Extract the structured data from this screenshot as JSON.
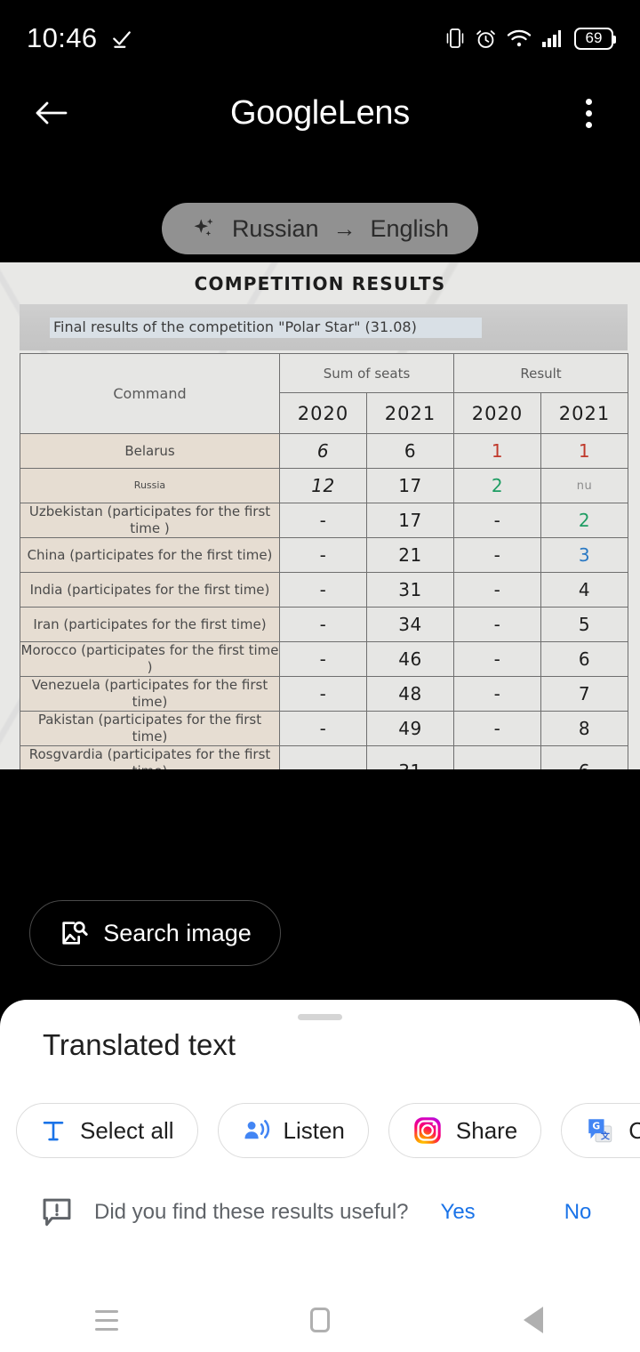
{
  "status_bar": {
    "time": "10:46",
    "check_icon": "check-icon",
    "vibrate_icon": "vibrate-icon",
    "alarm_icon": "alarm-icon",
    "wifi_icon": "wifi-icon",
    "signal_icon": "cellular-signal-icon",
    "battery_level": "69"
  },
  "app_bar": {
    "back_icon": "back-arrow-icon",
    "title_primary": "Google",
    "title_secondary": "Lens",
    "overflow_icon": "more-vertical-icon"
  },
  "language_chip": {
    "sparkle_icon": "sparkle-icon",
    "source_language": "Russian",
    "arrow": "→",
    "target_language": "English"
  },
  "document": {
    "heading": "COMPETITION RESULTS",
    "caption": "Final results of the competition \"Polar Star\" (31.08)",
    "table": {
      "col_command": "Command",
      "group_headers": [
        "Sum of seats",
        "Result"
      ],
      "year_headers": [
        "2020",
        "2021",
        "2020",
        "2021"
      ],
      "rows": [
        {
          "name": "Belarus",
          "seats_2020": "6",
          "seats_2021": "6",
          "result_2020": "1",
          "result_2021": "1",
          "r20_color": "red",
          "r21_color": "red",
          "name_style": "normal",
          "s20_style": "italic",
          "s21_style": "normal"
        },
        {
          "name": "Russia",
          "seats_2020": "12",
          "seats_2021": "17",
          "result_2020": "2",
          "result_2021": "nu",
          "r20_color": "green",
          "r21_color": "faint",
          "name_style": "small",
          "s20_style": "italic",
          "s21_style": "normal"
        },
        {
          "name": "Uzbekistan (participates for the first time )",
          "seats_2020": "-",
          "seats_2021": "17",
          "result_2020": "-",
          "result_2021": "2",
          "r20_color": "",
          "r21_color": "green",
          "name_style": "normal",
          "s20_style": "normal",
          "s21_style": "normal"
        },
        {
          "name": "China (participates for the first time)",
          "seats_2020": "-",
          "seats_2021": "21",
          "result_2020": "-",
          "result_2021": "3",
          "r20_color": "",
          "r21_color": "blue",
          "name_style": "normal",
          "s20_style": "normal",
          "s21_style": "normal"
        },
        {
          "name": "India (participates for the first time)",
          "seats_2020": "-",
          "seats_2021": "31",
          "result_2020": "-",
          "result_2021": "4",
          "r20_color": "",
          "r21_color": "bold",
          "name_style": "normal",
          "s20_style": "normal",
          "s21_style": "normal"
        },
        {
          "name": "Iran (participates for the first time)",
          "seats_2020": "-",
          "seats_2021": "34",
          "result_2020": "-",
          "result_2021": "5",
          "r20_color": "",
          "r21_color": "bold",
          "name_style": "normal",
          "s20_style": "normal",
          "s21_style": "normal"
        },
        {
          "name": "Morocco (participates for the first time )",
          "seats_2020": "-",
          "seats_2021": "46",
          "result_2020": "-",
          "result_2021": "6",
          "r20_color": "",
          "r21_color": "bold",
          "name_style": "normal",
          "s20_style": "normal",
          "s21_style": "normal"
        },
        {
          "name": "Venezuela (participates for the first time)",
          "seats_2020": "-",
          "seats_2021": "48",
          "result_2020": "-",
          "result_2021": "7",
          "r20_color": "",
          "r21_color": "bold",
          "name_style": "normal",
          "s20_style": "normal",
          "s21_style": "normal"
        },
        {
          "name": "Pakistan (participates for the first time)",
          "seats_2020": "-",
          "seats_2021": "49",
          "result_2020": "-",
          "result_2021": "8",
          "r20_color": "",
          "r21_color": "bold",
          "name_style": "normal",
          "s20_style": "normal",
          "s21_style": "normal"
        },
        {
          "name": "Rosgvardia (participates for the first time)\n(out of offset)",
          "seats_2020": "-",
          "seats_2021": "31",
          "result_2020": "-",
          "result_2021": "6",
          "r20_color": "",
          "r21_color": "bold",
          "name_style": "normal",
          "s20_style": "normal",
          "s21_style": "normal"
        }
      ]
    }
  },
  "search_image_button": {
    "label": "Search image",
    "icon": "image-search-icon"
  },
  "bottom_sheet": {
    "grabber": "drag-handle",
    "title": "Translated text",
    "chips": [
      {
        "label": "Select all",
        "icon": "text-select-icon"
      },
      {
        "label": "Listen",
        "icon": "listen-speaker-icon"
      },
      {
        "label": "Share",
        "icon": "instagram-share-icon"
      },
      {
        "label": "C",
        "icon": "google-translate-icon"
      }
    ],
    "feedback": {
      "icon": "feedback-icon",
      "question": "Did you find these results useful?",
      "yes": "Yes",
      "no": "No"
    }
  },
  "nav_bar": {
    "recents_icon": "recents-icon",
    "home_icon": "home-icon",
    "back_icon": "nav-back-icon"
  },
  "colors": {
    "accent_blue": "#1a73e8",
    "result_red": "#c0392b",
    "result_green": "#1f9d63",
    "result_blue": "#2a79c4",
    "chip_bg": "#919191",
    "row_name_bg": "#e6ddd2",
    "row_value_bg": "#e6e6e4"
  }
}
